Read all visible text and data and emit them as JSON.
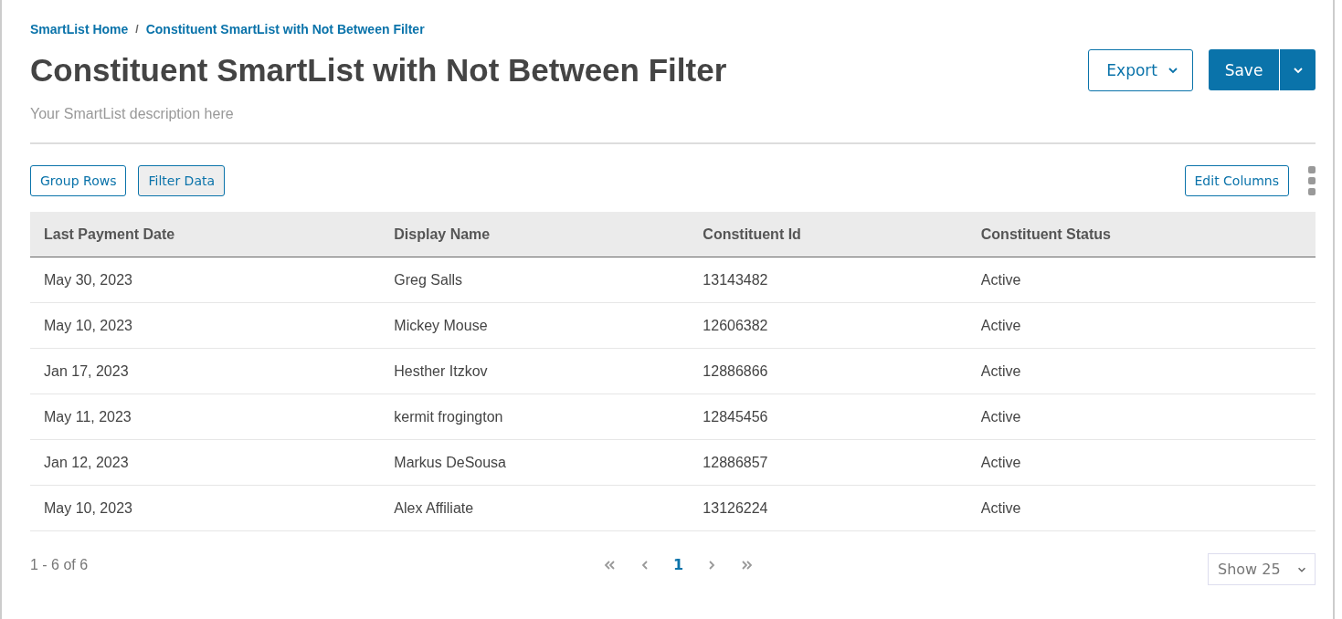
{
  "breadcrumbs": [
    "SmartList Home",
    "Constituent SmartList with Not Between Filter"
  ],
  "breadcrumb_separator": "/",
  "title": "Constituent SmartList with Not Between Filter",
  "description": "Your SmartList description here",
  "export_button": "Export",
  "save_button": "Save",
  "toolbar_buttons": [
    {
      "label": "Group Rows",
      "active": false
    },
    {
      "label": "Filter Data",
      "active": true
    }
  ],
  "edit_columns_button": "Edit Columns",
  "table": {
    "columns": [
      "Last Payment Date",
      "Display Name",
      "Constituent Id",
      "Constituent Status"
    ],
    "rows": [
      [
        "May 30, 2023",
        "Greg Salls",
        "13143482",
        "Active"
      ],
      [
        "May 10, 2023",
        "Mickey Mouse",
        "12606382",
        "Active"
      ],
      [
        "Jan 17, 2023",
        "Hesther Itzkov",
        "12886866",
        "Active"
      ],
      [
        "May 11, 2023",
        "kermit frogington",
        "12845456",
        "Active"
      ],
      [
        "Jan 12, 2023",
        "Markus DeSousa",
        "12886857",
        "Active"
      ],
      [
        "May 10, 2023",
        "Alex Affiliate",
        "13126224",
        "Active"
      ]
    ]
  },
  "pagination": {
    "summary": "1 - 6 of 6",
    "pages": [
      {
        "label": "1",
        "selected": true
      }
    ],
    "page_size": "Show 25"
  }
}
